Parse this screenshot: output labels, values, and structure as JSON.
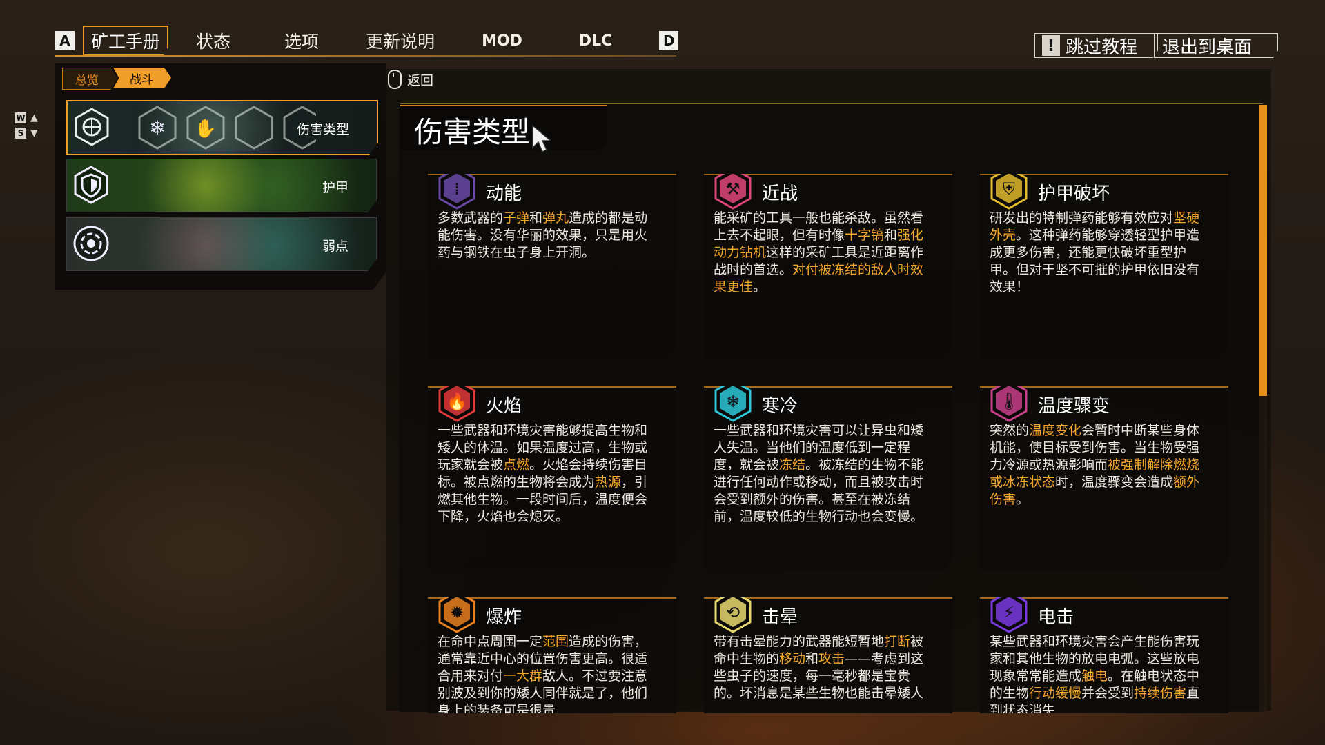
{
  "top_menu": {
    "key_left": "A",
    "key_right": "D",
    "tabs": [
      {
        "label": "矿工手册",
        "active": true
      },
      {
        "label": "状态"
      },
      {
        "label": "选项"
      },
      {
        "label": "更新说明"
      },
      {
        "label": "MOD"
      },
      {
        "label": "DLC"
      }
    ],
    "skip_tutorial": "跳过教程",
    "skip_icon": "!",
    "exit_desktop": "退出到桌面"
  },
  "breadcrumb": [
    "总览",
    "战斗"
  ],
  "key_hints": {
    "up_key": "W",
    "down_key": "S"
  },
  "back_hint": "返回",
  "categories": [
    {
      "label": "伤害类型",
      "icon": "hex-damage-icon",
      "selected": true
    },
    {
      "label": "护甲",
      "icon": "shield-icon"
    },
    {
      "label": "弱点",
      "icon": "target-icon"
    }
  ],
  "page_title": "伤害类型",
  "colors": {
    "accent": "#f0a02a",
    "highlight": "#f4a62c",
    "panel": "#0c0b09"
  },
  "cards": [
    {
      "title": "动能",
      "icon": "bullets-icon",
      "icon_color": "#6a4aa8",
      "body": [
        {
          "t": "多数武器的"
        },
        {
          "t": "子弹",
          "h": true
        },
        {
          "t": "和"
        },
        {
          "t": "弹丸",
          "h": true
        },
        {
          "t": "造成的都是动能伤害。没有华丽的效果，只是用火药与钢铁在虫子身上开洞。"
        }
      ]
    },
    {
      "title": "近战",
      "icon": "pickaxe-icon",
      "icon_color": "#e0457a",
      "body": [
        {
          "t": "能采矿的工具一般也能杀敌。虽然看上去不起眼，但有时像"
        },
        {
          "t": "十字镐",
          "h": true
        },
        {
          "t": "和"
        },
        {
          "t": "强化动力钻机",
          "h": true
        },
        {
          "t": "这样的采矿工具是近距离作战时的首选。"
        },
        {
          "t": "对付被冻结的敌人时效果更佳",
          "h": true
        },
        {
          "t": "。"
        }
      ]
    },
    {
      "title": "护甲破坏",
      "icon": "armor-break-icon",
      "icon_color": "#e2b92a",
      "body": [
        {
          "t": "研发出的特制弹药能够有效应对"
        },
        {
          "t": "坚硬外壳",
          "h": true
        },
        {
          "t": "。这种弹药能够穿透轻型护甲造成更多伤害，还能更快破坏重型护甲。但对于坚不可摧的护甲依旧没有效果！"
        }
      ]
    },
    {
      "title": "火焰",
      "icon": "fire-icon",
      "icon_color": "#e03a3a",
      "body": [
        {
          "t": "一些武器和环境灾害能够提高生物和矮人的体温。如果温度过高，生物或玩家就会被"
        },
        {
          "t": "点燃",
          "h": true
        },
        {
          "t": "。火焰会持续伤害目标。被点燃的生物将会成为"
        },
        {
          "t": "热源",
          "h": true
        },
        {
          "t": "，引燃其他生物。一段时间后，温度便会下降，火焰也会熄灭。"
        }
      ]
    },
    {
      "title": "寒冷",
      "icon": "snowflake-icon",
      "icon_color": "#2ec8d8",
      "body": [
        {
          "t": "一些武器和环境灾害可以让异虫和矮人失温。当他们的温度低到一定程度，就会被"
        },
        {
          "t": "冻结",
          "h": true
        },
        {
          "t": "。被冻结的生物不能进行任何动作或移动，而且被攻击时会受到额外的伤害。甚至在被冻结前，温度较低的生物行动也会变慢。"
        }
      ]
    },
    {
      "title": "温度骤变",
      "icon": "thermometer-icon",
      "icon_color": "#c8408a",
      "body": [
        {
          "t": "突然的"
        },
        {
          "t": "温度变化",
          "h": true
        },
        {
          "t": "会暂时中断某些身体机能，使目标受到伤害。当生物受强力冷源或热源影响而"
        },
        {
          "t": "被强制解除燃烧或冰冻状态",
          "h": true
        },
        {
          "t": "时，温度骤变会造成"
        },
        {
          "t": "额外伤害",
          "h": true
        },
        {
          "t": "。"
        }
      ]
    },
    {
      "title": "爆炸",
      "icon": "explosion-icon",
      "icon_color": "#e8801e",
      "body": [
        {
          "t": "在命中点周围一定"
        },
        {
          "t": "范围",
          "h": true
        },
        {
          "t": "造成的伤害，通常靠近中心的位置伤害更高。很适合用来对付"
        },
        {
          "t": "一大群",
          "h": true
        },
        {
          "t": "敌人。不过要注意别波及到你的矮人同伴就是了，他们身上的装备可是很贵"
        }
      ]
    },
    {
      "title": "击晕",
      "icon": "stun-icon",
      "icon_color": "#e8d870",
      "body": [
        {
          "t": "带有击晕能力的武器能短暂地"
        },
        {
          "t": "打断",
          "h": true
        },
        {
          "t": "被命中生物的"
        },
        {
          "t": "移动",
          "h": true
        },
        {
          "t": "和"
        },
        {
          "t": "攻击",
          "h": true
        },
        {
          "t": "——考虑到这些虫子的速度，每一毫秒都是宝贵的。坏消息是某些生物也能击晕矮人"
        }
      ]
    },
    {
      "title": "电击",
      "icon": "lightning-icon",
      "icon_color": "#7a3ae0",
      "body": [
        {
          "t": "某些武器和环境灾害会产生能伤害玩家和其他生物的放电电弧。这些放电现象常常能造成"
        },
        {
          "t": "触电",
          "h": true
        },
        {
          "t": "。在触电状态中的生物"
        },
        {
          "t": "行动缓慢",
          "h": true
        },
        {
          "t": "并会受到"
        },
        {
          "t": "持续伤害",
          "h": true
        },
        {
          "t": "直到状态消失"
        }
      ]
    }
  ]
}
